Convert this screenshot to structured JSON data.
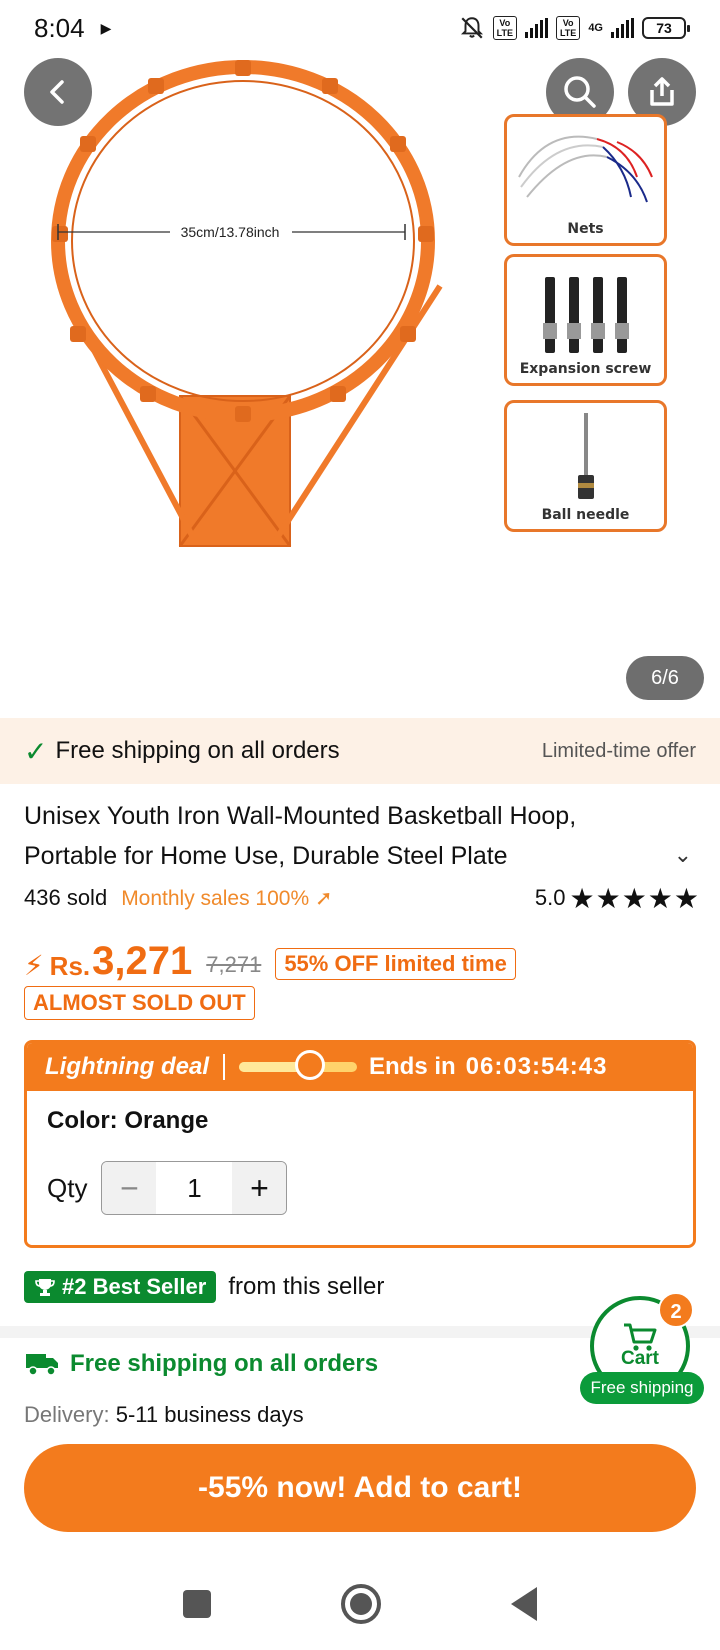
{
  "status_bar": {
    "time": "8:04",
    "battery": "73",
    "network": "4G",
    "volte_1": "Vo\nLTE",
    "volte_2": "Vo\nLTE"
  },
  "gallery": {
    "counter": "6/6",
    "measure_label": "35cm/13.78inch",
    "thumbnails": [
      {
        "caption": "Nets"
      },
      {
        "caption": "Expansion screw"
      },
      {
        "caption": "Ball needle"
      }
    ]
  },
  "shipping_banner": {
    "label": "Free shipping on all orders",
    "offer": "Limited-time offer"
  },
  "product": {
    "title": "Unisex Youth Iron Wall-Mounted Basketball Hoop, Portable for Home Use, Durable Steel Plate",
    "sold": "436 sold",
    "monthly_sales": "Monthly sales 100%",
    "rating": "5.0",
    "stars_count": 5,
    "currency": "Rs.",
    "price": "3,271",
    "old_price": "7,271",
    "discount_badge": "55% OFF limited time",
    "stock_badge": "ALMOST SOLD OUT"
  },
  "deal": {
    "label": "Lightning deal",
    "progress_fraction": 0.6,
    "ends_label": "Ends in",
    "timer": "06:03:54:43",
    "color_label": "Color: Orange",
    "qty_label": "Qty",
    "qty_value": "1",
    "minus": "−",
    "plus": "+"
  },
  "seller": {
    "badge": "#2 Best Seller",
    "text": "from this seller"
  },
  "delivery": {
    "free_shipping": "Free shipping on all orders",
    "key": "Delivery:",
    "value": "5-11 business days"
  },
  "cart": {
    "label": "Cart",
    "count": "2",
    "free": "Free shipping"
  },
  "cta": {
    "label": "-55% now! Add to cart!"
  },
  "colors": {
    "accent": "#f37b1d",
    "green": "#0b8a2f"
  }
}
